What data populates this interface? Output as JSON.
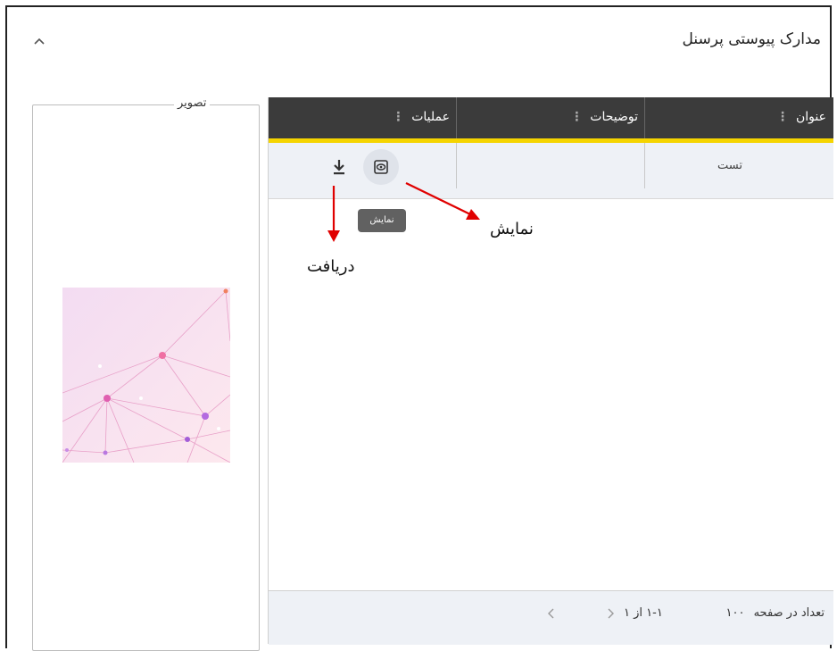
{
  "panel": {
    "title": "مدارک پیوستی پرسنل",
    "collapse_icon": "chevron-up-icon"
  },
  "image_panel": {
    "legend": "تصویر"
  },
  "table": {
    "columns": [
      {
        "label": "عنوان",
        "menu_icon": "more-vert-icon"
      },
      {
        "label": "توضیحات",
        "menu_icon": "more-vert-icon"
      },
      {
        "label": "عملیات",
        "menu_icon": "more-vert-icon"
      }
    ],
    "rows": [
      {
        "title": "تست",
        "description": "",
        "actions": [
          "view",
          "download"
        ]
      }
    ],
    "tooltip": "نمایش"
  },
  "paginator": {
    "page_size_label": "تعداد در صفحه",
    "page_size": "۱۰۰",
    "range": "۱-۱ از ۱"
  },
  "annotations": {
    "view_label": "نمایش",
    "download_label": "دریافت",
    "arrow_color": "#e00000"
  },
  "colors": {
    "header_bg": "#3b3b3b",
    "header_accent": "#f5d400",
    "row_bg": "#eef1f6"
  }
}
